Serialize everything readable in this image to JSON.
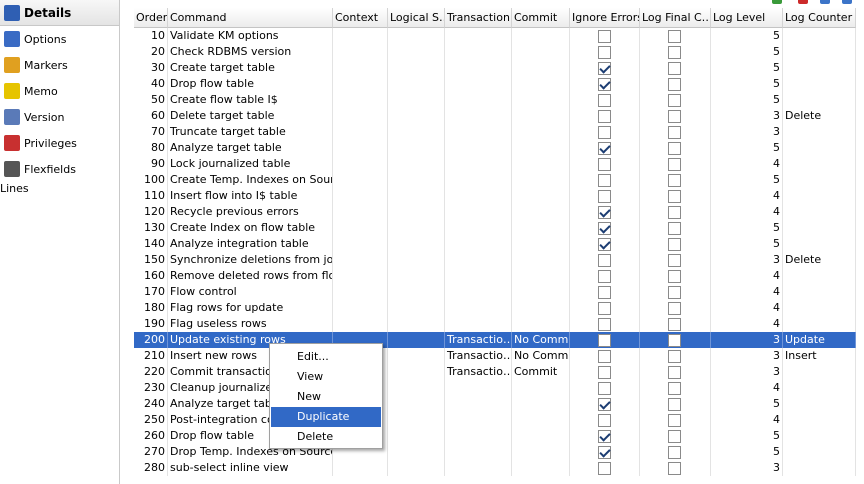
{
  "sidebar": {
    "items": [
      {
        "label": "Details",
        "icon": "details-icon",
        "active": true
      },
      {
        "label": "Options",
        "icon": "options-icon"
      },
      {
        "label": "Markers",
        "icon": "markers-icon"
      },
      {
        "label": "Memo",
        "icon": "memo-icon"
      },
      {
        "label": "Version",
        "icon": "version-icon"
      },
      {
        "label": "Privileges",
        "icon": "privileges-icon"
      },
      {
        "label": "Flexfields",
        "icon": "flexfields-icon"
      }
    ],
    "lines_label": "Lines"
  },
  "grid": {
    "columns": [
      "Order",
      "Command",
      "Context",
      "Logical S…",
      "Transaction",
      "Commit",
      "Ignore Errors",
      "Log Final C…",
      "Log Level",
      "Log Counter"
    ],
    "rows": [
      {
        "order": "10",
        "command": "Validate KM options",
        "context": "",
        "logical": "",
        "transaction": "",
        "commit": "",
        "ignore": false,
        "logfinal": false,
        "level": "5",
        "counter": ""
      },
      {
        "order": "20",
        "command": "Check RDBMS version",
        "context": "",
        "logical": "",
        "transaction": "",
        "commit": "",
        "ignore": false,
        "logfinal": false,
        "level": "5",
        "counter": ""
      },
      {
        "order": "30",
        "command": "Create target table",
        "context": "",
        "logical": "",
        "transaction": "",
        "commit": "",
        "ignore": true,
        "logfinal": false,
        "level": "5",
        "counter": ""
      },
      {
        "order": "40",
        "command": "Drop flow table",
        "context": "",
        "logical": "",
        "transaction": "",
        "commit": "",
        "ignore": true,
        "logfinal": false,
        "level": "5",
        "counter": ""
      },
      {
        "order": "50",
        "command": "Create flow table I$",
        "context": "",
        "logical": "",
        "transaction": "",
        "commit": "",
        "ignore": false,
        "logfinal": false,
        "level": "5",
        "counter": ""
      },
      {
        "order": "60",
        "command": "Delete target table",
        "context": "",
        "logical": "",
        "transaction": "",
        "commit": "",
        "ignore": false,
        "logfinal": false,
        "level": "3",
        "counter": "Delete"
      },
      {
        "order": "70",
        "command": "Truncate target table",
        "context": "",
        "logical": "",
        "transaction": "",
        "commit": "",
        "ignore": false,
        "logfinal": false,
        "level": "3",
        "counter": ""
      },
      {
        "order": "80",
        "command": "Analyze target table",
        "context": "",
        "logical": "",
        "transaction": "",
        "commit": "",
        "ignore": true,
        "logfinal": false,
        "level": "5",
        "counter": ""
      },
      {
        "order": "90",
        "command": "Lock journalized table",
        "context": "",
        "logical": "",
        "transaction": "",
        "commit": "",
        "ignore": false,
        "logfinal": false,
        "level": "4",
        "counter": ""
      },
      {
        "order": "100",
        "command": "Create Temp. Indexes on Source",
        "context": "",
        "logical": "",
        "transaction": "",
        "commit": "",
        "ignore": false,
        "logfinal": false,
        "level": "5",
        "counter": ""
      },
      {
        "order": "110",
        "command": "Insert flow into I$ table",
        "context": "",
        "logical": "",
        "transaction": "",
        "commit": "",
        "ignore": false,
        "logfinal": false,
        "level": "4",
        "counter": ""
      },
      {
        "order": "120",
        "command": "Recycle previous errors",
        "context": "",
        "logical": "",
        "transaction": "",
        "commit": "",
        "ignore": true,
        "logfinal": false,
        "level": "4",
        "counter": ""
      },
      {
        "order": "130",
        "command": "Create Index on flow table",
        "context": "",
        "logical": "",
        "transaction": "",
        "commit": "",
        "ignore": true,
        "logfinal": false,
        "level": "5",
        "counter": ""
      },
      {
        "order": "140",
        "command": "Analyze integration table",
        "context": "",
        "logical": "",
        "transaction": "",
        "commit": "",
        "ignore": true,
        "logfinal": false,
        "level": "5",
        "counter": ""
      },
      {
        "order": "150",
        "command": "Synchronize deletions from jou…",
        "context": "",
        "logical": "",
        "transaction": "",
        "commit": "",
        "ignore": false,
        "logfinal": false,
        "level": "3",
        "counter": "Delete"
      },
      {
        "order": "160",
        "command": "Remove deleted rows from flo…",
        "context": "",
        "logical": "",
        "transaction": "",
        "commit": "",
        "ignore": false,
        "logfinal": false,
        "level": "4",
        "counter": ""
      },
      {
        "order": "170",
        "command": "Flow control",
        "context": "",
        "logical": "",
        "transaction": "",
        "commit": "",
        "ignore": false,
        "logfinal": false,
        "level": "4",
        "counter": ""
      },
      {
        "order": "180",
        "command": "Flag rows for update",
        "context": "",
        "logical": "",
        "transaction": "",
        "commit": "",
        "ignore": false,
        "logfinal": false,
        "level": "4",
        "counter": ""
      },
      {
        "order": "190",
        "command": "Flag useless rows",
        "context": "",
        "logical": "",
        "transaction": "",
        "commit": "",
        "ignore": false,
        "logfinal": false,
        "level": "4",
        "counter": ""
      },
      {
        "order": "200",
        "command": "Update existing rows",
        "context": "",
        "logical": "",
        "transaction": "Transactio…",
        "commit": "No Commit",
        "ignore": false,
        "logfinal": false,
        "level": "3",
        "counter": "Update",
        "selected": true
      },
      {
        "order": "210",
        "command": "Insert new rows",
        "context": "",
        "logical": "",
        "transaction": "Transactio…",
        "commit": "No Commit",
        "ignore": false,
        "logfinal": false,
        "level": "3",
        "counter": "Insert"
      },
      {
        "order": "220",
        "command": "Commit transaction",
        "context": "",
        "logical": "",
        "transaction": "Transactio…",
        "commit": "Commit",
        "ignore": false,
        "logfinal": false,
        "level": "3",
        "counter": ""
      },
      {
        "order": "230",
        "command": "Cleanup journalized t",
        "context": "",
        "logical": "",
        "transaction": "",
        "commit": "",
        "ignore": false,
        "logfinal": false,
        "level": "4",
        "counter": ""
      },
      {
        "order": "240",
        "command": "Analyze target table",
        "context": "",
        "logical": "",
        "transaction": "",
        "commit": "",
        "ignore": true,
        "logfinal": false,
        "level": "5",
        "counter": ""
      },
      {
        "order": "250",
        "command": "Post-integration cont",
        "context": "",
        "logical": "",
        "transaction": "",
        "commit": "",
        "ignore": false,
        "logfinal": false,
        "level": "4",
        "counter": ""
      },
      {
        "order": "260",
        "command": "Drop flow table",
        "context": "",
        "logical": "",
        "transaction": "",
        "commit": "",
        "ignore": true,
        "logfinal": false,
        "level": "5",
        "counter": ""
      },
      {
        "order": "270",
        "command": "Drop Temp. Indexes on Source",
        "context": "",
        "logical": "",
        "transaction": "",
        "commit": "",
        "ignore": true,
        "logfinal": false,
        "level": "5",
        "counter": ""
      },
      {
        "order": "280",
        "command": "sub-select inline view",
        "context": "",
        "logical": "",
        "transaction": "",
        "commit": "",
        "ignore": false,
        "logfinal": false,
        "level": "3",
        "counter": ""
      }
    ]
  },
  "context_menu": {
    "items": [
      {
        "label": "Edit..."
      },
      {
        "label": "View"
      },
      {
        "label": "New"
      },
      {
        "label": "Duplicate",
        "highlighted": true
      },
      {
        "label": "Delete"
      }
    ]
  },
  "colors": {
    "selection": "#3169c6",
    "grid_line": "#e3e3e3"
  }
}
